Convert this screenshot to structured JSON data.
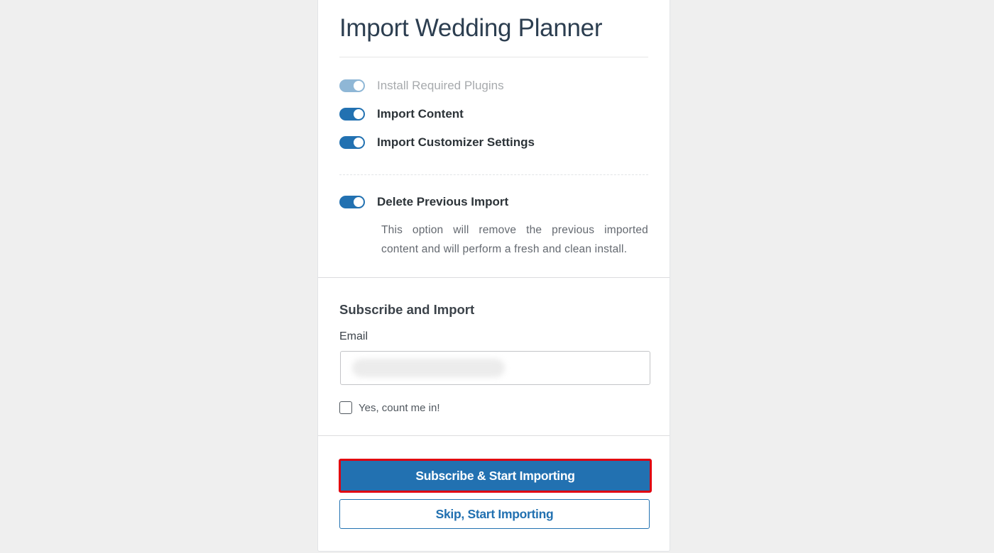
{
  "page": {
    "title": "Import Wedding Planner"
  },
  "options": [
    {
      "label": "Install Required Plugins",
      "enabled": true,
      "disabled": true
    },
    {
      "label": "Import Content",
      "enabled": true,
      "disabled": false
    },
    {
      "label": "Import Customizer Settings",
      "enabled": true,
      "disabled": false
    }
  ],
  "delete_previous": {
    "label": "Delete Previous Import",
    "enabled": true,
    "description": "This option will remove the previous imported content and will perform a fresh and clean install."
  },
  "subscribe": {
    "title": "Subscribe and Import",
    "email_label": "Email",
    "email_value": "",
    "consent_label": "Yes, count me in!",
    "consent_checked": false
  },
  "actions": {
    "primary_label": "Subscribe & Start Importing",
    "secondary_label": "Skip, Start Importing"
  },
  "colors": {
    "accent": "#2271b1",
    "highlight_border": "#e00010",
    "background": "#efefef"
  }
}
